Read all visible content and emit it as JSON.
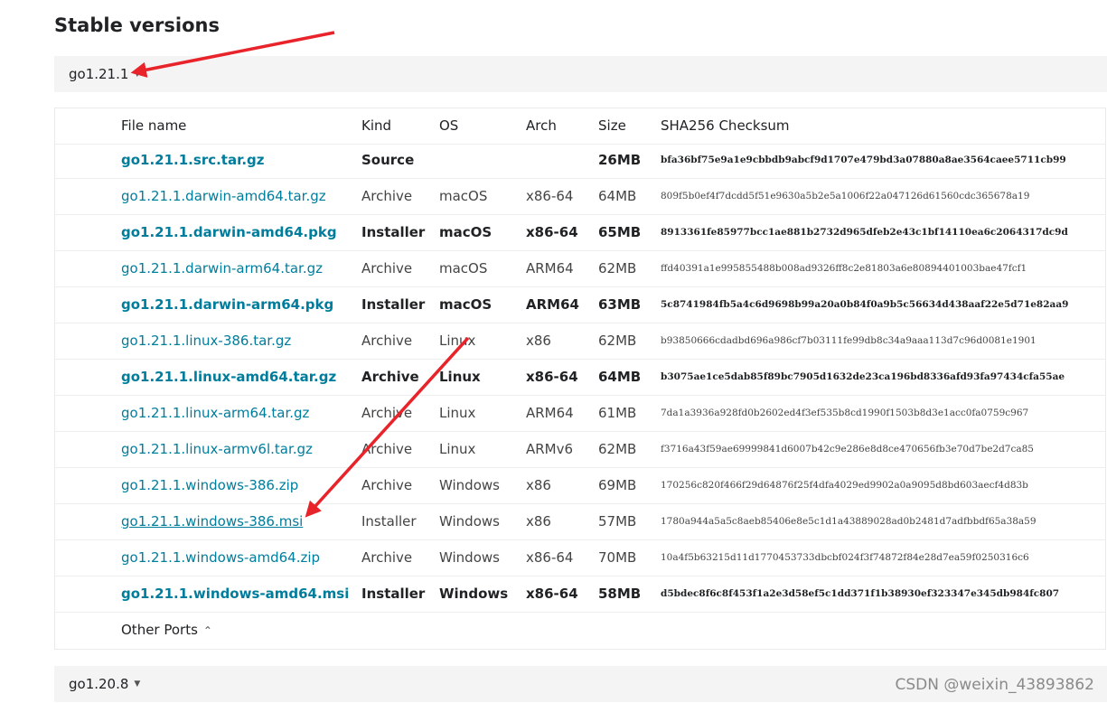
{
  "page_title": "Stable versions",
  "current_version": "go1.21.1",
  "next_version": "go1.20.8",
  "headers": {
    "name": "File name",
    "kind": "Kind",
    "os": "OS",
    "arch": "Arch",
    "size": "Size",
    "sha": "SHA256 Checksum"
  },
  "rows": [
    {
      "name": "go1.21.1.src.tar.gz",
      "kind": "Source",
      "os": "",
      "arch": "",
      "size": "26MB",
      "sha": "bfa36bf75e9a1e9cbbdb9abcf9d1707e479bd3a07880a8ae3564caee5711cb99",
      "bold": true
    },
    {
      "name": "go1.21.1.darwin-amd64.tar.gz",
      "kind": "Archive",
      "os": "macOS",
      "arch": "x86-64",
      "size": "64MB",
      "sha": "809f5b0ef4f7dcdd5f51e9630a5b2e5a1006f22a047126d61560cdc365678a19",
      "bold": false
    },
    {
      "name": "go1.21.1.darwin-amd64.pkg",
      "kind": "Installer",
      "os": "macOS",
      "arch": "x86-64",
      "size": "65MB",
      "sha": "8913361fe85977bcc1ae881b2732d965dfeb2e43c1bf14110ea6c2064317dc9d",
      "bold": true
    },
    {
      "name": "go1.21.1.darwin-arm64.tar.gz",
      "kind": "Archive",
      "os": "macOS",
      "arch": "ARM64",
      "size": "62MB",
      "sha": "ffd40391a1e995855488b008ad9326ff8c2e81803a6e80894401003bae47fcf1",
      "bold": false
    },
    {
      "name": "go1.21.1.darwin-arm64.pkg",
      "kind": "Installer",
      "os": "macOS",
      "arch": "ARM64",
      "size": "63MB",
      "sha": "5c8741984fb5a4c6d9698b99a20a0b84f0a9b5c56634d438aaf22e5d71e82aa9",
      "bold": true
    },
    {
      "name": "go1.21.1.linux-386.tar.gz",
      "kind": "Archive",
      "os": "Linux",
      "arch": "x86",
      "size": "62MB",
      "sha": "b93850666cdadbd696a986cf7b03111fe99db8c34a9aaa113d7c96d0081e1901",
      "bold": false
    },
    {
      "name": "go1.21.1.linux-amd64.tar.gz",
      "kind": "Archive",
      "os": "Linux",
      "arch": "x86-64",
      "size": "64MB",
      "sha": "b3075ae1ce5dab85f89bc7905d1632de23ca196bd8336afd93fa97434cfa55ae",
      "bold": true
    },
    {
      "name": "go1.21.1.linux-arm64.tar.gz",
      "kind": "Archive",
      "os": "Linux",
      "arch": "ARM64",
      "size": "61MB",
      "sha": "7da1a3936a928fd0b2602ed4f3ef535b8cd1990f1503b8d3e1acc0fa0759c967",
      "bold": false
    },
    {
      "name": "go1.21.1.linux-armv6l.tar.gz",
      "kind": "Archive",
      "os": "Linux",
      "arch": "ARMv6",
      "size": "62MB",
      "sha": "f3716a43f59ae69999841d6007b42c9e286e8d8ce470656fb3e70d7be2d7ca85",
      "bold": false
    },
    {
      "name": "go1.21.1.windows-386.zip",
      "kind": "Archive",
      "os": "Windows",
      "arch": "x86",
      "size": "69MB",
      "sha": "170256c820f466f29d64876f25f4dfa4029ed9902a0a9095d8bd603aecf4d83b",
      "bold": false
    },
    {
      "name": "go1.21.1.windows-386.msi",
      "kind": "Installer",
      "os": "Windows",
      "arch": "x86",
      "size": "57MB",
      "sha": "1780a944a5a5c8aeb85406e8e5c1d1a43889028ad0b2481d7adfbbdf65a38a59",
      "bold": false,
      "underline": true
    },
    {
      "name": "go1.21.1.windows-amd64.zip",
      "kind": "Archive",
      "os": "Windows",
      "arch": "x86-64",
      "size": "70MB",
      "sha": "10a4f5b63215d11d1770453733dbcbf024f3f74872f84e28d7ea59f0250316c6",
      "bold": false
    },
    {
      "name": "go1.21.1.windows-amd64.msi",
      "kind": "Installer",
      "os": "Windows",
      "arch": "x86-64",
      "size": "58MB",
      "sha": "d5bdec8f6c8f453f1a2e3d58ef5c1dd371f1b38930ef323347e345db984fc807",
      "bold": true
    }
  ],
  "other_ports": "Other Ports",
  "watermark": "CSDN @weixin_43893862",
  "colors": {
    "link": "#007d9c",
    "arrow": "#e8232a",
    "bar": "#f4f4f5"
  },
  "icons": {
    "version_toggle": "caret-down-icon",
    "other_ports_toggle": "chevron-up-icon"
  }
}
